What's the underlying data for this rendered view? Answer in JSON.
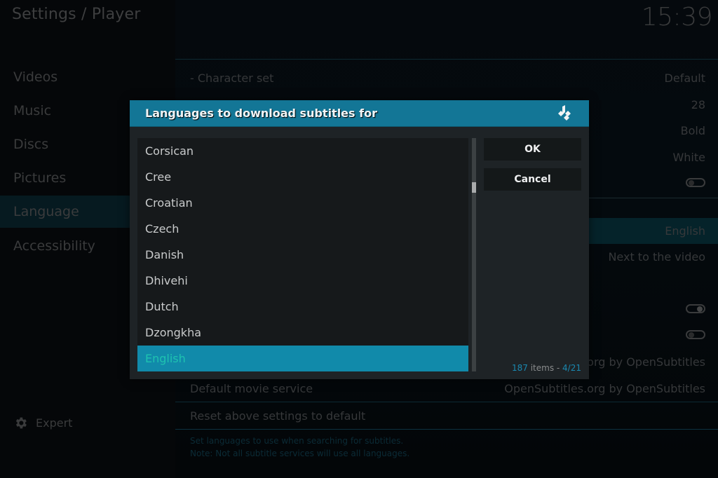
{
  "header": {
    "title": "Settings / Player",
    "clock": "15:39"
  },
  "sidebar": {
    "items": [
      {
        "label": "Videos",
        "active": false
      },
      {
        "label": "Music",
        "active": false
      },
      {
        "label": "Discs",
        "active": false
      },
      {
        "label": "Pictures",
        "active": false
      },
      {
        "label": "Language",
        "active": true
      },
      {
        "label": "Accessibility",
        "active": false
      }
    ],
    "expert": {
      "icon": "gear-icon",
      "label": "Expert"
    }
  },
  "settings": {
    "rows": [
      {
        "label": "- Character set",
        "value": "Default"
      },
      {
        "label": "",
        "value": "28"
      },
      {
        "label": "",
        "value": "Bold"
      },
      {
        "label": "",
        "value": "White"
      },
      {
        "label": "",
        "toggle": "off"
      },
      {
        "label": "",
        "value": "English"
      },
      {
        "label": "",
        "value": "Next to the video"
      },
      {
        "label": "",
        "toggle": "on"
      },
      {
        "label": "",
        "toggle": "off"
      },
      {
        "label": "",
        "value": ".org by OpenSubtitles"
      },
      {
        "label": "Default movie service",
        "value": "OpenSubtitles.org by OpenSubtitles"
      },
      {
        "label": "Reset above settings to default",
        "value": ""
      }
    ],
    "help": [
      "Set languages to use when searching for subtitles.",
      "Note: Not all subtitle services will use all languages."
    ]
  },
  "dialog": {
    "title": "Languages to download subtitles for",
    "logo_icon": "kodi-logo-icon",
    "items": [
      "Corsican",
      "Cree",
      "Croatian",
      "Czech",
      "Danish",
      "Dhivehi",
      "Dutch",
      "Dzongkha",
      "English"
    ],
    "selected_index": 8,
    "buttons": {
      "ok": "OK",
      "cancel": "Cancel"
    },
    "count": {
      "items": "187",
      "items_label": " items - ",
      "page": "4/21"
    },
    "accent": "#118aaa"
  }
}
